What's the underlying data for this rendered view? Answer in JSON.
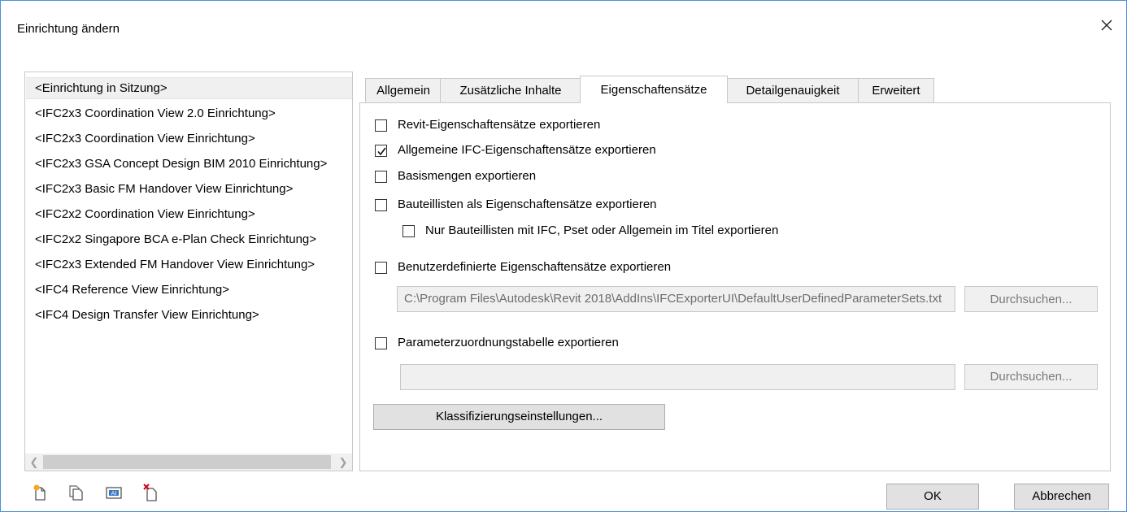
{
  "window": {
    "title": "Einrichtung ändern",
    "close_icon": "close-icon"
  },
  "setups": [
    "<Einrichtung in Sitzung>",
    "<IFC2x3 Coordination View 2.0 Einrichtung>",
    "<IFC2x3 Coordination View Einrichtung>",
    "<IFC2x3 GSA Concept Design BIM 2010 Einrichtung>",
    "<IFC2x3 Basic FM Handover View Einrichtung>",
    "<IFC2x2 Coordination View Einrichtung>",
    "<IFC2x2 Singapore BCA e-Plan Check Einrichtung>",
    "<IFC2x3 Extended FM Handover View Einrichtung>",
    "<IFC4 Reference View Einrichtung>",
    "<IFC4 Design Transfer View Einrichtung>"
  ],
  "tabs": [
    "Allgemein",
    "Zusätzliche Inhalte",
    "Eigenschaftensätze",
    "Detailgenauigkeit",
    "Erweitert"
  ],
  "active_tab": "Eigenschaftensätze",
  "options": {
    "revit_psets": {
      "label": "Revit-Eigenschaftensätze exportieren",
      "checked": false
    },
    "ifc_psets": {
      "label": "Allgemeine IFC-Eigenschaftensätze exportieren",
      "checked": true
    },
    "base_quantities": {
      "label": "Basismengen exportieren",
      "checked": false
    },
    "schedules": {
      "label": "Bauteillisten als Eigenschaftensätze exportieren",
      "checked": false
    },
    "schedules_filter": {
      "label": "Nur Bauteillisten mit IFC, Pset oder Allgemein im Titel exportieren",
      "checked": false
    },
    "user_defined": {
      "label": "Benutzerdefinierte Eigenschaftensätze exportieren",
      "checked": false
    },
    "user_defined_path": "C:\\Program Files\\Autodesk\\Revit 2018\\AddIns\\IFCExporterUI\\DefaultUserDefinedParameterSets.txt",
    "param_mapping": {
      "label": "Parameterzuordnungstabelle exportieren",
      "checked": false
    },
    "param_mapping_path": ""
  },
  "buttons": {
    "browse_1": "Durchsuchen...",
    "browse_2": "Durchsuchen...",
    "classification": "Klassifizierungseinstellungen...",
    "ok": "OK",
    "cancel": "Abbrechen"
  },
  "toolbar_icons": [
    "new-setup-icon",
    "duplicate-setup-icon",
    "rename-setup-icon",
    "delete-setup-icon"
  ]
}
